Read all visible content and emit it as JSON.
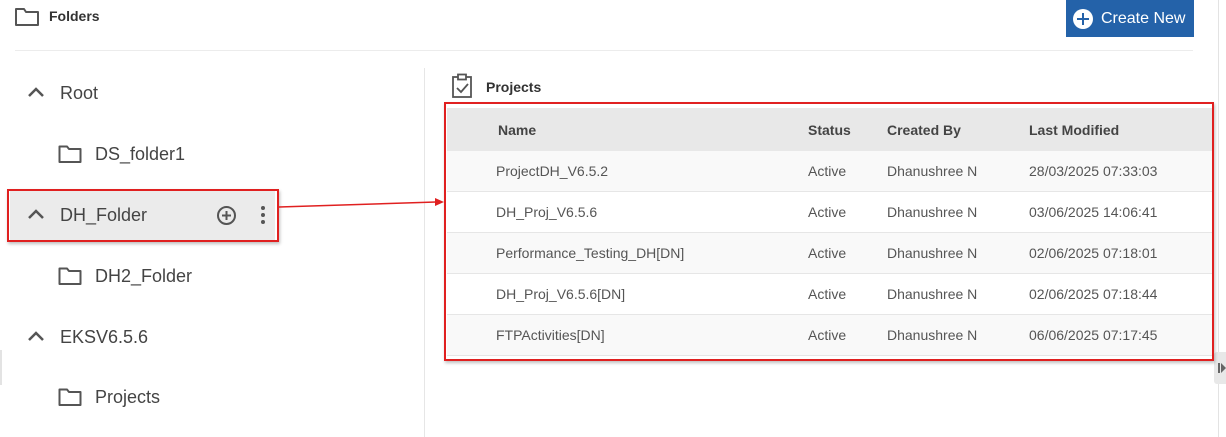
{
  "header": {
    "title": "Folders",
    "create_button": "Create New"
  },
  "tree": {
    "items": [
      {
        "label": "Root",
        "kind": "group",
        "expanded": true
      },
      {
        "label": "DS_folder1",
        "kind": "folder"
      },
      {
        "label": "DH_Folder",
        "kind": "group",
        "expanded": true,
        "selected": true
      },
      {
        "label": "DH2_Folder",
        "kind": "folder"
      },
      {
        "label": "EKSV6.5.6",
        "kind": "group",
        "expanded": true
      },
      {
        "label": "Projects",
        "kind": "folder"
      }
    ]
  },
  "panel": {
    "title": "Projects",
    "columns": [
      "Name",
      "Status",
      "Created By",
      "Last Modified"
    ],
    "rows": [
      {
        "name": "ProjectDH_V6.5.2",
        "status": "Active",
        "created_by": "Dhanushree N",
        "last_modified": "28/03/2025 07:33:03"
      },
      {
        "name": "DH_Proj_V6.5.6",
        "status": "Active",
        "created_by": "Dhanushree N",
        "last_modified": "03/06/2025 14:06:41"
      },
      {
        "name": "Performance_Testing_DH[DN]",
        "status": "Active",
        "created_by": "Dhanushree N",
        "last_modified": "02/06/2025 07:18:01"
      },
      {
        "name": "DH_Proj_V6.5.6[DN]",
        "status": "Active",
        "created_by": "Dhanushree N",
        "last_modified": "02/06/2025 07:18:44"
      },
      {
        "name": "FTPActivities[DN]",
        "status": "Active",
        "created_by": "Dhanushree N",
        "last_modified": "06/06/2025 07:17:45"
      }
    ]
  },
  "colors": {
    "accent": "#2462a9",
    "highlight": "#e02020",
    "selected_bg": "#ebebeb",
    "header_bg": "#e8e8e8"
  },
  "icons": [
    "folder-icon",
    "plus-circle-icon",
    "chevron-up-icon",
    "add-circle-icon",
    "more-vertical-icon",
    "clipboard-check-icon"
  ]
}
